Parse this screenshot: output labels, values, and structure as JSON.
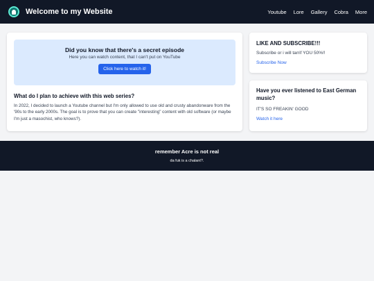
{
  "header": {
    "title": "Welcome to my Website",
    "logo_icon": "house-icon",
    "nav": [
      "Youtube",
      "Lore",
      "Gallery",
      "Cobra",
      "More"
    ]
  },
  "main": {
    "promo": {
      "title": "Did you know that there's a secret episode",
      "subtitle": "Here you can watch content, that I can't put on YouTube",
      "button_label": "Click here to watch it!"
    },
    "section": {
      "title": "What do I plan to achieve with this web series?",
      "body": "In 2022, I decided to launch a Youtube channel but I'm only allowed to use old and crusty abandonware from the '90s to the early 2000s. The goal is to prove that you can create \"interesting\" content with old software (or maybe I'm just a masochist, who knows?)."
    }
  },
  "sidebar": {
    "card1": {
      "title": "LIKE AND SUBSCRIBE!!!",
      "text": "Subscribe or i will tarrif YOU 50%!!",
      "link": "Subscribe Now"
    },
    "card2": {
      "title": "Have you ever listened to East German music?",
      "text": "IT'S SO FREAKIN' GOOD",
      "link": "Watch it here"
    }
  },
  "footer": {
    "title": "remember Acre is not real",
    "subtitle": "da fuk is a chalant?."
  },
  "colors": {
    "header_bg": "#111827",
    "accent": "#2563eb",
    "promo_bg": "#dbeafe",
    "page_bg": "#f3f4f6"
  }
}
